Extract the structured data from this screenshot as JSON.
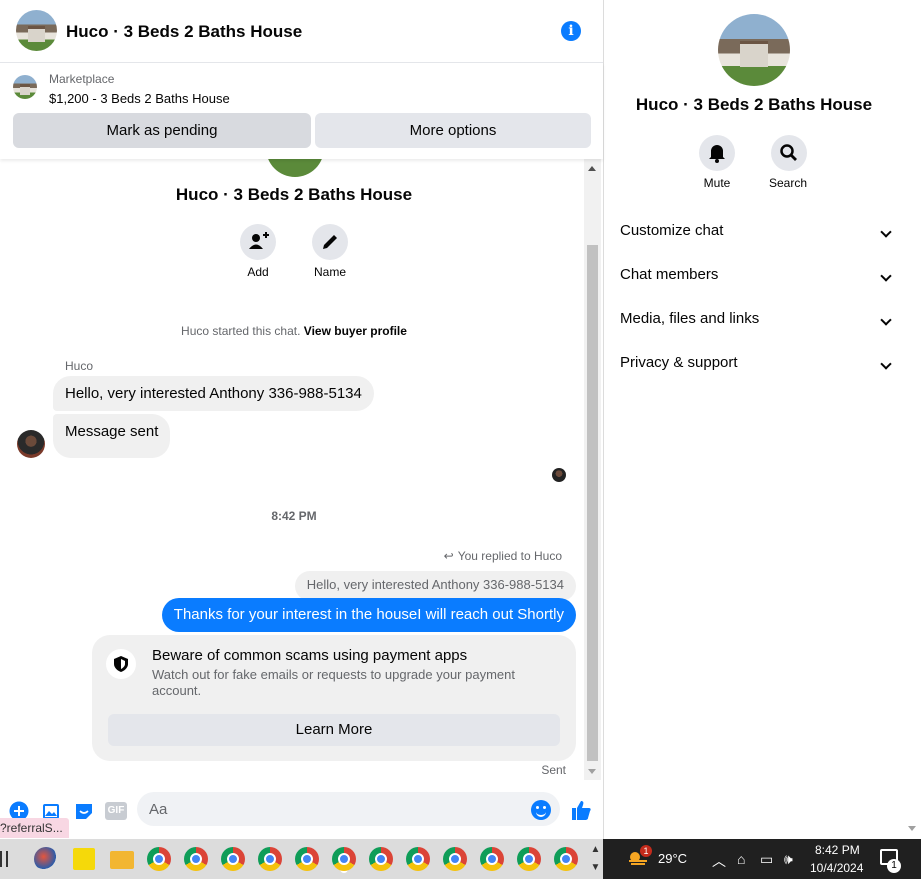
{
  "header": {
    "title": "Huco · 3 Beds 2 Baths House",
    "info_icon": "info-icon"
  },
  "marketplace": {
    "label": "Marketplace",
    "listing": "$1,200 - 3 Beds 2 Baths House",
    "mark_pending": "Mark as pending",
    "more_options": "More options"
  },
  "conversation": {
    "title": "Huco · 3 Beds 2 Baths House",
    "add_label": "Add",
    "name_label": "Name",
    "started_text": "Huco started this chat.",
    "view_profile": "View buyer profile",
    "sender": "Huco",
    "messages_in": [
      "Hello, very interested Anthony 336-988-5134",
      "Message sent"
    ],
    "timestamp": "8:42 PM",
    "reply_note": "You replied to Huco",
    "quoted": "Hello, very interested Anthony 336-988-5134",
    "message_out": "Thanks for your interest in the houseI will reach out Shortly",
    "warning": {
      "title": "Beware of common scams using payment apps",
      "text": "Watch out for fake emails or requests to upgrade your payment account.",
      "button": "Learn More"
    },
    "status": "Sent"
  },
  "composer": {
    "placeholder": "Aa",
    "gif_label": "GIF"
  },
  "referral_tooltip": "?referralS...",
  "side_panel": {
    "title": "Huco · 3 Beds 2 Baths House",
    "mute": "Mute",
    "search": "Search",
    "sections": [
      "Customize chat",
      "Chat members",
      "Media, files and links",
      "Privacy & support"
    ]
  },
  "taskbar": {
    "temperature": "29°C",
    "weather_badge": "1",
    "time": "8:42 PM",
    "date": "10/4/2024",
    "notification_count": "1"
  },
  "colors": {
    "accent": "#0a7cff",
    "bubble_gray": "#f0f0f0",
    "button_gray": "#e4e6eb"
  }
}
